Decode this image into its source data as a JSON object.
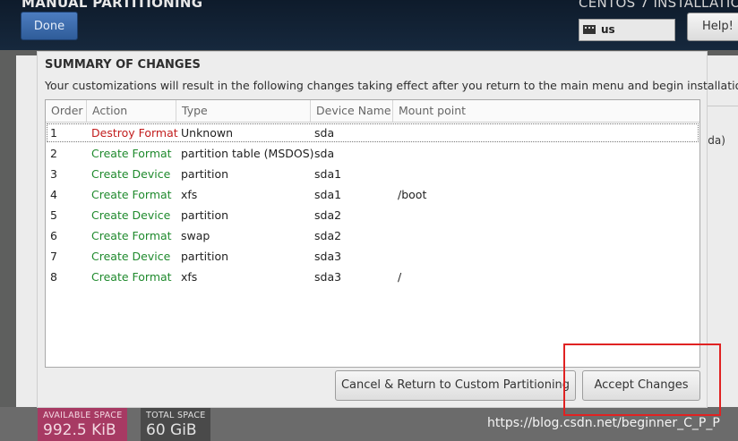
{
  "header": {
    "title": "MANUAL PARTITIONING",
    "done_label": "Done",
    "right_title": "CENTOS 7 INSTALLATIO",
    "keyboard_layout": "us",
    "help_label": "Help!"
  },
  "background": {
    "side_text": "sda)"
  },
  "storage": {
    "available_label": "AVAILABLE SPACE",
    "available_value": "992.5 KiB",
    "total_label": "TOTAL SPACE",
    "total_value": "60 GiB"
  },
  "dialog": {
    "title": "SUMMARY OF CHANGES",
    "subtitle": "Your customizations will result in the following changes taking effect after you return to the main menu and begin installation:",
    "columns": [
      "Order",
      "Action",
      "Type",
      "Device Name",
      "Mount point"
    ],
    "rows": [
      {
        "order": "1",
        "action": "Destroy Format",
        "type": "Unknown",
        "device": "sda",
        "mount": ""
      },
      {
        "order": "2",
        "action": "Create Format",
        "type": "partition table (MSDOS)",
        "device": "sda",
        "mount": ""
      },
      {
        "order": "3",
        "action": "Create Device",
        "type": "partition",
        "device": "sda1",
        "mount": ""
      },
      {
        "order": "4",
        "action": "Create Format",
        "type": "xfs",
        "device": "sda1",
        "mount": "/boot"
      },
      {
        "order": "5",
        "action": "Create Device",
        "type": "partition",
        "device": "sda2",
        "mount": ""
      },
      {
        "order": "6",
        "action": "Create Format",
        "type": "swap",
        "device": "sda2",
        "mount": ""
      },
      {
        "order": "7",
        "action": "Create Device",
        "type": "partition",
        "device": "sda3",
        "mount": ""
      },
      {
        "order": "8",
        "action": "Create Format",
        "type": "xfs",
        "device": "sda3",
        "mount": "/"
      }
    ],
    "cancel_label": "Cancel & Return to Custom Partitioning",
    "accept_label": "Accept Changes"
  },
  "watermark": "https://blog.csdn.net/beginner_C_P_P",
  "colors": {
    "destroy": "#c21d1d",
    "create": "#1f8a2d",
    "highlight_box": "#e02222"
  }
}
